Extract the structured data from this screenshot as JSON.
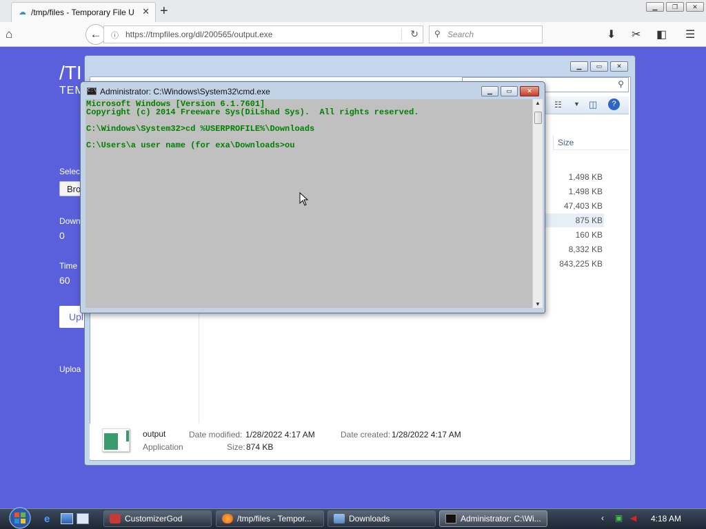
{
  "browser": {
    "tab_title": "/tmp/files - Temporary File U",
    "url": "https://tmpfiles.org/dl/200565/output.exe",
    "search_placeholder": "Search"
  },
  "page": {
    "title": "/TI",
    "subtitle": "TEM",
    "select_label": "Selec",
    "browse_button": "Bro",
    "downloads_label": "Down",
    "downloads_value": "0",
    "time_label": "Time",
    "time_value": "60",
    "upload_button": "Upl",
    "uploads_label": "Uploa"
  },
  "explorer": {
    "size_header": "Size",
    "sizes": [
      "1,498 KB",
      "1,498 KB",
      "47,403 KB",
      "875 KB",
      "160 KB",
      "8,332 KB",
      "843,225 KB"
    ],
    "details": {
      "name": "output",
      "type": "Application",
      "modified_label": "Date modified:",
      "modified_value": "1/28/2022 4:17 AM",
      "created_label": "Date created:",
      "created_value": "1/28/2022 4:17 AM",
      "size_label": "Size:",
      "size_value": "874 KB"
    }
  },
  "cmd": {
    "title": "Administrator: C:\\Windows\\System32\\cmd.exe",
    "lines": [
      "Microsoft Windows [Version 6.1.7601]",
      "Copyright (c) 2014 Freeware Sys(DiLshad Sys).  All rights reserved.",
      "C:\\Windows\\System32>cd %USERPROFILE%\\Downloads",
      "C:\\Users\\a user name (for exa\\Downloads>ou"
    ]
  },
  "taskbar": {
    "tasks": [
      "CustomizerGod",
      "/tmp/files - Tempor...",
      "Downloads",
      "Administrator: C:\\Wi..."
    ],
    "clock": "4:18 AM"
  }
}
